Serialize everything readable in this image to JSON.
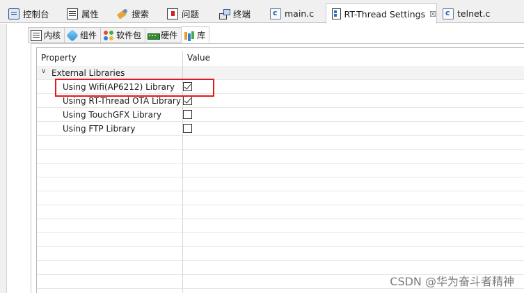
{
  "top_tabs": [
    {
      "label": "控制台",
      "icon": "console-icon"
    },
    {
      "label": "属性",
      "icon": "properties-icon"
    },
    {
      "label": "搜索",
      "icon": "search-icon"
    },
    {
      "label": "问题",
      "icon": "problems-icon"
    },
    {
      "label": "终端",
      "icon": "terminal-icon"
    },
    {
      "label": "main.c",
      "icon": "c-file-icon"
    },
    {
      "label": "RT-Thread Settings",
      "icon": "settings-icon",
      "active": true,
      "close": "☒"
    },
    {
      "label": "telnet.c",
      "icon": "c-file-icon"
    }
  ],
  "sub_tabs": [
    {
      "label": "内核",
      "icon": "kernel-icon"
    },
    {
      "label": "组件",
      "icon": "component-icon"
    },
    {
      "label": "软件包",
      "icon": "package-icon"
    },
    {
      "label": "硬件",
      "icon": "hardware-icon"
    },
    {
      "label": "库",
      "icon": "library-icon",
      "active": true
    }
  ],
  "table": {
    "header_property": "Property",
    "header_value": "Value",
    "group": {
      "label": "External Libraries",
      "expanded": true,
      "chevron": "∨"
    },
    "rows": [
      {
        "label": "Using Wifi(AP6212) Library",
        "checked": true,
        "highlighted": true
      },
      {
        "label": "Using RT-Thread OTA Library",
        "checked": true
      },
      {
        "label": "Using TouchGFX Library",
        "checked": false
      },
      {
        "label": "Using FTP Library",
        "checked": false
      }
    ]
  },
  "watermark": "CSDN @华为奋斗者精神",
  "colors": {
    "highlight": "#e0191c",
    "background": "#ffffff",
    "tabbar": "#f0f0f0"
  }
}
